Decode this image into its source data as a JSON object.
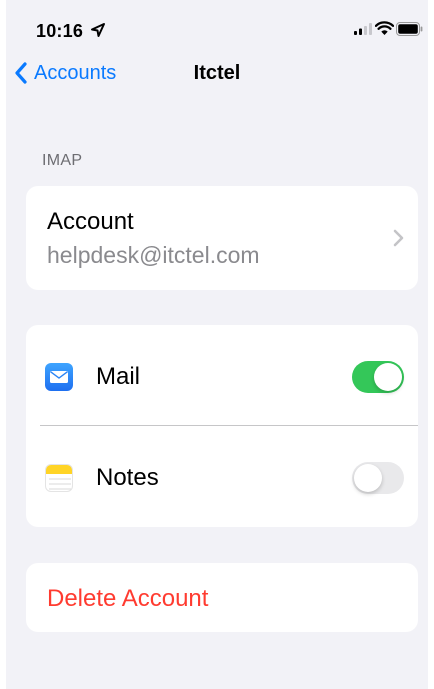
{
  "status_bar": {
    "time": "10:16",
    "icons": [
      "location-arrow-icon",
      "cellular-signal-icon",
      "wifi-icon",
      "battery-icon"
    ]
  },
  "nav": {
    "back_label": "Accounts",
    "title": "Itctel"
  },
  "section": {
    "header": "IMAP"
  },
  "account": {
    "title": "Account",
    "email": "helpdesk@itctel.com"
  },
  "toggles": [
    {
      "label": "Mail",
      "icon": "mail-app-icon",
      "state": "on"
    },
    {
      "label": "Notes",
      "icon": "notes-app-icon",
      "state": "off"
    }
  ],
  "delete_label": "Delete Account",
  "colors": {
    "accent": "#0a7aff",
    "toggle_on": "#34c759",
    "toggle_off": "#e9e9eb",
    "destructive": "#ff3b30",
    "background": "#f2f2f7",
    "secondary_text": "#8a8a8e"
  }
}
